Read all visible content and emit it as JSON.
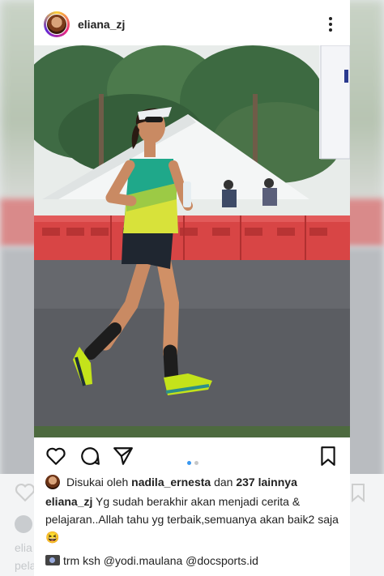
{
  "post": {
    "username": "eliana_zj",
    "likes": {
      "prefix": "Disukai oleh",
      "user": "nadila_ernesta",
      "middle": "dan",
      "count_text": "237 lainnya"
    },
    "caption": {
      "username": "eliana_zj",
      "text": "Yg sudah berakhir akan menjadi cerita & pelajaran..Allah tahu yg terbaik,semuanya akan baik2 saja😆"
    },
    "credit": {
      "prefix": "trm ksh",
      "mention1": "@yodi.maulana",
      "mention2": "@docsports.id"
    },
    "carousel": {
      "count": 2,
      "active_index": 0
    }
  },
  "background": {
    "username_fragment": "elia",
    "text_fragment": "pelaj"
  },
  "icons": {
    "more": "more-vertical-icon",
    "like": "heart-icon",
    "comment": "comment-icon",
    "share": "send-icon",
    "save": "bookmark-icon"
  },
  "colors": {
    "accent": "#3897f0",
    "text": "#222222",
    "barrier_red": "#d84545",
    "jersey_green": "#1fa88a",
    "jersey_yellow": "#d8e23a"
  }
}
